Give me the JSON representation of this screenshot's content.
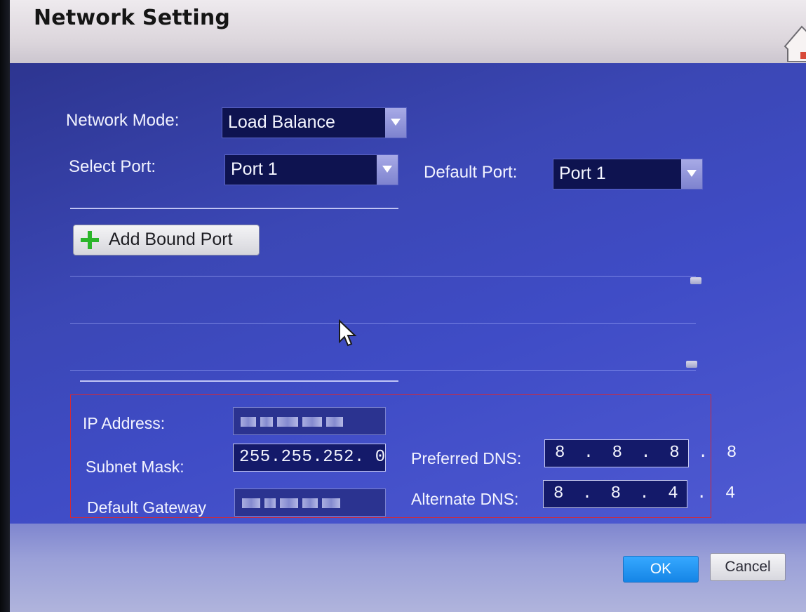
{
  "window": {
    "title": "Network Setting"
  },
  "network": {
    "mode_label": "Network Mode:",
    "mode_value": "Load Balance",
    "select_port_label": "Select Port:",
    "select_port_value": "Port 1",
    "default_port_label": "Default Port:",
    "default_port_value": "Port 1",
    "add_bound_port_label": "Add Bound Port"
  },
  "ip": {
    "ip_address_label": "IP Address:",
    "subnet_mask_label": "Subnet Mask:",
    "subnet_mask_value": "255.255.252. 0",
    "default_gateway_label": "Default Gateway",
    "preferred_dns_label": "Preferred DNS:",
    "preferred_dns_value": "8 . 8 . 8 . 8",
    "alternate_dns_label": "Alternate DNS:",
    "alternate_dns_value": "8 . 8 . 4 . 4"
  },
  "buttons": {
    "ok_label": "OK",
    "cancel_label": "Cancel"
  },
  "icons": {
    "home": "home-icon",
    "dropdown": "chevron-down-icon",
    "add": "plus-icon",
    "cursor": "mouse-pointer-icon"
  },
  "colors": {
    "accent_ok": "#1f8ff0",
    "highlight_border": "#d02a3a",
    "add_icon": "#2bb52b"
  }
}
